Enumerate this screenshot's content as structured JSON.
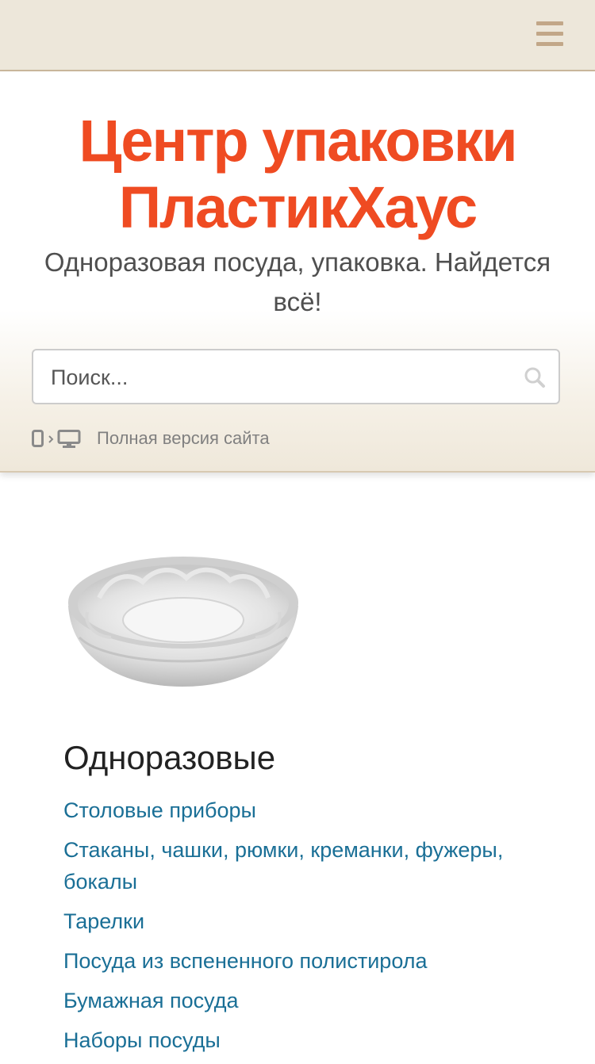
{
  "topbar": {
    "menu_icon": "hamburger-menu-icon",
    "bg_color": "#ede7da",
    "icon_color": "#c2a788"
  },
  "header": {
    "title_line1": "Центр упаковки",
    "title_line2": "ПластикХаус",
    "title_color": "#ef4b22",
    "tagline": "Одноразовая посуда, упаковка. Найдется всё!"
  },
  "search": {
    "placeholder": "Поиск...",
    "value": "",
    "icon": "search-icon"
  },
  "full_version": {
    "icons": [
      "mobile-phone-icon",
      "chevron-right-icon",
      "desktop-monitor-icon"
    ],
    "label": "Полная версия сайта"
  },
  "product": {
    "image": "plastic-bowl-image"
  },
  "category": {
    "title": "Одноразовые",
    "link_color": "#1a6f96",
    "links": [
      "Столовые приборы",
      "Стаканы, чашки, рюмки, креманки, фужеры, бокалы",
      "Тарелки",
      "Посуда из вспененного полистирола",
      "Бумажная посуда",
      "Наборы посуды"
    ]
  }
}
